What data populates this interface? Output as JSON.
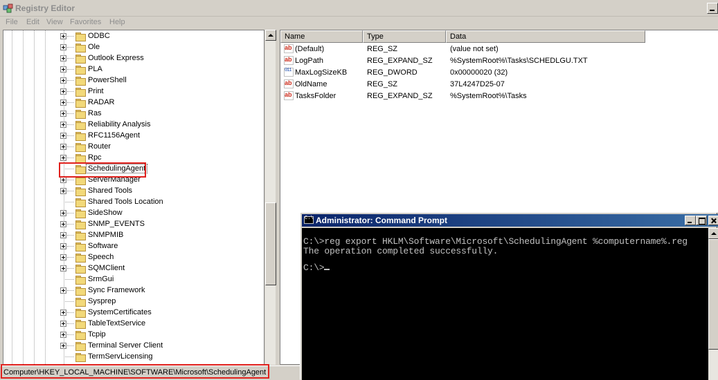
{
  "window": {
    "title": "Registry Editor"
  },
  "menu": [
    "File",
    "Edit",
    "View",
    "Favorites",
    "Help"
  ],
  "tree": {
    "items": [
      {
        "label": "ODBC",
        "expandable": true
      },
      {
        "label": "Ole",
        "expandable": true
      },
      {
        "label": "Outlook Express",
        "expandable": true
      },
      {
        "label": "PLA",
        "expandable": true
      },
      {
        "label": "PowerShell",
        "expandable": true
      },
      {
        "label": "Print",
        "expandable": true
      },
      {
        "label": "RADAR",
        "expandable": true
      },
      {
        "label": "Ras",
        "expandable": true
      },
      {
        "label": "Reliability Analysis",
        "expandable": true
      },
      {
        "label": "RFC1156Agent",
        "expandable": true
      },
      {
        "label": "Router",
        "expandable": true
      },
      {
        "label": "Rpc",
        "expandable": true
      },
      {
        "label": "SchedulingAgent",
        "expandable": false,
        "selected": true
      },
      {
        "label": "ServerManager",
        "expandable": true
      },
      {
        "label": "Shared Tools",
        "expandable": true
      },
      {
        "label": "Shared Tools Location",
        "expandable": false
      },
      {
        "label": "SideShow",
        "expandable": true
      },
      {
        "label": "SNMP_EVENTS",
        "expandable": true
      },
      {
        "label": "SNMPMIB",
        "expandable": true
      },
      {
        "label": "Software",
        "expandable": true
      },
      {
        "label": "Speech",
        "expandable": true
      },
      {
        "label": "SQMClient",
        "expandable": true
      },
      {
        "label": "SrmGui",
        "expandable": false
      },
      {
        "label": "Sync Framework",
        "expandable": true
      },
      {
        "label": "Sysprep",
        "expandable": false
      },
      {
        "label": "SystemCertificates",
        "expandable": true
      },
      {
        "label": "TableTextService",
        "expandable": true
      },
      {
        "label": "Tcpip",
        "expandable": true
      },
      {
        "label": "Terminal Server Client",
        "expandable": true
      },
      {
        "label": "TermServLicensing",
        "expandable": false
      }
    ]
  },
  "list": {
    "columns": [
      "Name",
      "Type",
      "Data"
    ],
    "rows": [
      {
        "icon": "string-value-icon",
        "name": "(Default)",
        "type": "REG_SZ",
        "data": "(value not set)"
      },
      {
        "icon": "string-value-icon",
        "name": "LogPath",
        "type": "REG_EXPAND_SZ",
        "data": "%SystemRoot%\\Tasks\\SCHEDLGU.TXT"
      },
      {
        "icon": "dword-value-icon",
        "name": "MaxLogSizeKB",
        "type": "REG_DWORD",
        "data": "0x00000020 (32)"
      },
      {
        "icon": "string-value-icon",
        "name": "OldName",
        "type": "REG_SZ",
        "data": "37L4247D25-07"
      },
      {
        "icon": "string-value-icon",
        "name": "TasksFolder",
        "type": "REG_EXPAND_SZ",
        "data": "%SystemRoot%\\Tasks"
      }
    ]
  },
  "status": {
    "path": "Computer\\HKEY_LOCAL_MACHINE\\SOFTWARE\\Microsoft\\SchedulingAgent"
  },
  "cmd": {
    "title": "Administrator: Command Prompt",
    "lines": [
      "C:\\>reg export HKLM\\Software\\Microsoft\\SchedulingAgent %computername%.reg",
      "The operation completed successfully.",
      "",
      "C:\\>"
    ]
  },
  "colors": {
    "highlight": "#e0201c",
    "cmd_title": "#0a246a",
    "console_bg": "#000000",
    "console_text": "#c0c0c0"
  }
}
